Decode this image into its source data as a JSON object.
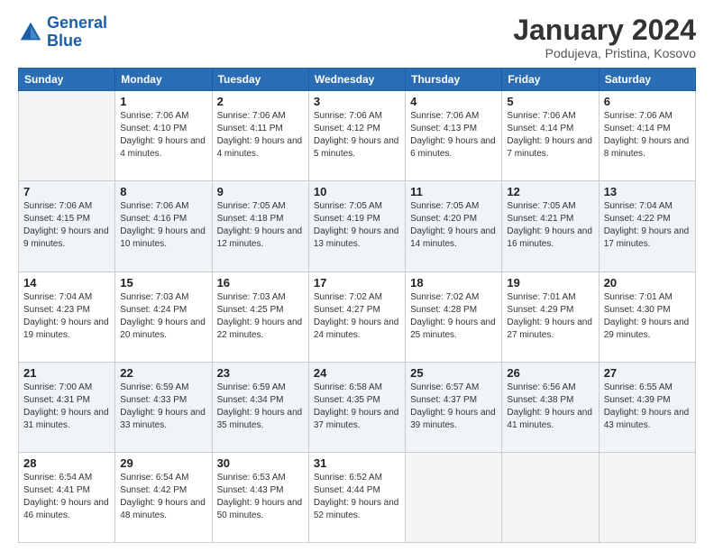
{
  "header": {
    "logo_line1": "General",
    "logo_line2": "Blue",
    "main_title": "January 2024",
    "subtitle": "Podujeva, Pristina, Kosovo"
  },
  "calendar": {
    "days_of_week": [
      "Sunday",
      "Monday",
      "Tuesday",
      "Wednesday",
      "Thursday",
      "Friday",
      "Saturday"
    ],
    "weeks": [
      [
        {
          "day": "",
          "empty": true
        },
        {
          "day": "1",
          "sunrise": "7:06 AM",
          "sunset": "4:10 PM",
          "daylight": "9 hours and 4 minutes."
        },
        {
          "day": "2",
          "sunrise": "7:06 AM",
          "sunset": "4:11 PM",
          "daylight": "9 hours and 4 minutes."
        },
        {
          "day": "3",
          "sunrise": "7:06 AM",
          "sunset": "4:12 PM",
          "daylight": "9 hours and 5 minutes."
        },
        {
          "day": "4",
          "sunrise": "7:06 AM",
          "sunset": "4:13 PM",
          "daylight": "9 hours and 6 minutes."
        },
        {
          "day": "5",
          "sunrise": "7:06 AM",
          "sunset": "4:14 PM",
          "daylight": "9 hours and 7 minutes."
        },
        {
          "day": "6",
          "sunrise": "7:06 AM",
          "sunset": "4:14 PM",
          "daylight": "9 hours and 8 minutes."
        }
      ],
      [
        {
          "day": "7",
          "sunrise": "7:06 AM",
          "sunset": "4:15 PM",
          "daylight": "9 hours and 9 minutes."
        },
        {
          "day": "8",
          "sunrise": "7:06 AM",
          "sunset": "4:16 PM",
          "daylight": "9 hours and 10 minutes."
        },
        {
          "day": "9",
          "sunrise": "7:05 AM",
          "sunset": "4:18 PM",
          "daylight": "9 hours and 12 minutes."
        },
        {
          "day": "10",
          "sunrise": "7:05 AM",
          "sunset": "4:19 PM",
          "daylight": "9 hours and 13 minutes."
        },
        {
          "day": "11",
          "sunrise": "7:05 AM",
          "sunset": "4:20 PM",
          "daylight": "9 hours and 14 minutes."
        },
        {
          "day": "12",
          "sunrise": "7:05 AM",
          "sunset": "4:21 PM",
          "daylight": "9 hours and 16 minutes."
        },
        {
          "day": "13",
          "sunrise": "7:04 AM",
          "sunset": "4:22 PM",
          "daylight": "9 hours and 17 minutes."
        }
      ],
      [
        {
          "day": "14",
          "sunrise": "7:04 AM",
          "sunset": "4:23 PM",
          "daylight": "9 hours and 19 minutes."
        },
        {
          "day": "15",
          "sunrise": "7:03 AM",
          "sunset": "4:24 PM",
          "daylight": "9 hours and 20 minutes."
        },
        {
          "day": "16",
          "sunrise": "7:03 AM",
          "sunset": "4:25 PM",
          "daylight": "9 hours and 22 minutes."
        },
        {
          "day": "17",
          "sunrise": "7:02 AM",
          "sunset": "4:27 PM",
          "daylight": "9 hours and 24 minutes."
        },
        {
          "day": "18",
          "sunrise": "7:02 AM",
          "sunset": "4:28 PM",
          "daylight": "9 hours and 25 minutes."
        },
        {
          "day": "19",
          "sunrise": "7:01 AM",
          "sunset": "4:29 PM",
          "daylight": "9 hours and 27 minutes."
        },
        {
          "day": "20",
          "sunrise": "7:01 AM",
          "sunset": "4:30 PM",
          "daylight": "9 hours and 29 minutes."
        }
      ],
      [
        {
          "day": "21",
          "sunrise": "7:00 AM",
          "sunset": "4:31 PM",
          "daylight": "9 hours and 31 minutes."
        },
        {
          "day": "22",
          "sunrise": "6:59 AM",
          "sunset": "4:33 PM",
          "daylight": "9 hours and 33 minutes."
        },
        {
          "day": "23",
          "sunrise": "6:59 AM",
          "sunset": "4:34 PM",
          "daylight": "9 hours and 35 minutes."
        },
        {
          "day": "24",
          "sunrise": "6:58 AM",
          "sunset": "4:35 PM",
          "daylight": "9 hours and 37 minutes."
        },
        {
          "day": "25",
          "sunrise": "6:57 AM",
          "sunset": "4:37 PM",
          "daylight": "9 hours and 39 minutes."
        },
        {
          "day": "26",
          "sunrise": "6:56 AM",
          "sunset": "4:38 PM",
          "daylight": "9 hours and 41 minutes."
        },
        {
          "day": "27",
          "sunrise": "6:55 AM",
          "sunset": "4:39 PM",
          "daylight": "9 hours and 43 minutes."
        }
      ],
      [
        {
          "day": "28",
          "sunrise": "6:54 AM",
          "sunset": "4:41 PM",
          "daylight": "9 hours and 46 minutes."
        },
        {
          "day": "29",
          "sunrise": "6:54 AM",
          "sunset": "4:42 PM",
          "daylight": "9 hours and 48 minutes."
        },
        {
          "day": "30",
          "sunrise": "6:53 AM",
          "sunset": "4:43 PM",
          "daylight": "9 hours and 50 minutes."
        },
        {
          "day": "31",
          "sunrise": "6:52 AM",
          "sunset": "4:44 PM",
          "daylight": "9 hours and 52 minutes."
        },
        {
          "day": "",
          "empty": true
        },
        {
          "day": "",
          "empty": true
        },
        {
          "day": "",
          "empty": true
        }
      ]
    ]
  }
}
